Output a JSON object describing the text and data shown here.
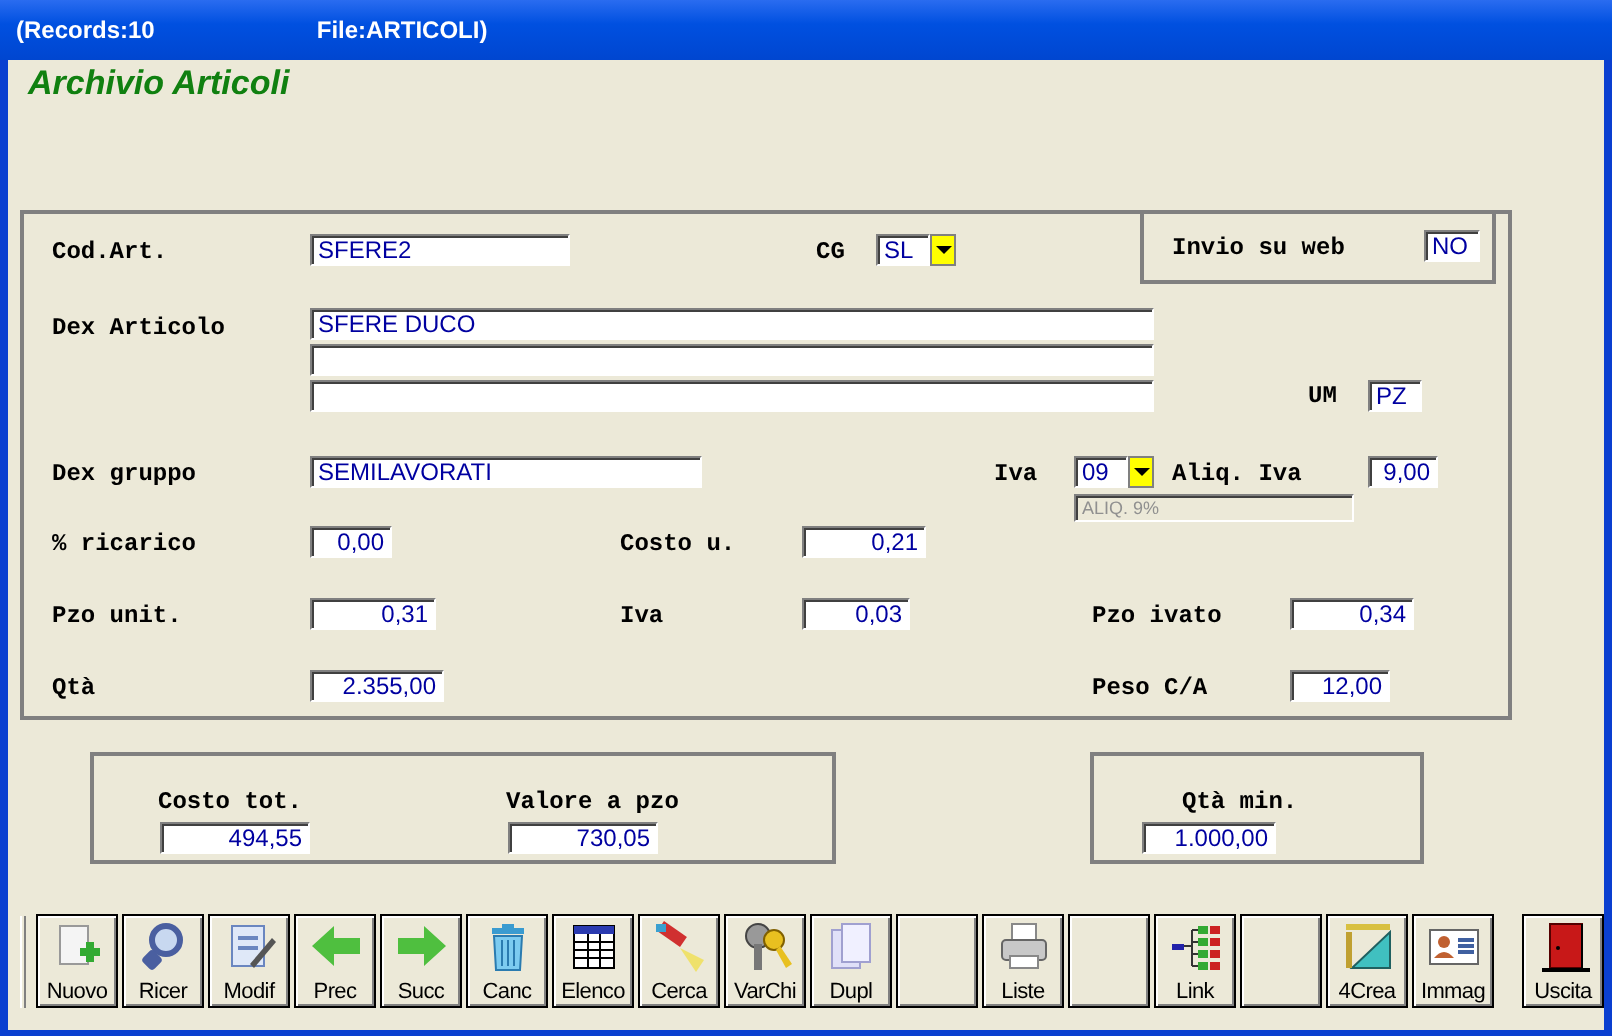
{
  "title_bar": {
    "records": "(Records:10",
    "file": "File:ARTICOLI)"
  },
  "heading": "Archivio Articoli",
  "main_form": {
    "fields": [
      {
        "label": "Cod.Art.",
        "kind": "text",
        "value": "SFERE2"
      },
      {
        "label": "CG",
        "kind": "combo",
        "value": "SL"
      },
      {
        "label": "Dex Articolo",
        "kind": "multiline",
        "value": "SFERE DUCO"
      },
      {
        "label": "UM",
        "kind": "text",
        "value": "PZ"
      },
      {
        "label": "Dex gruppo",
        "kind": "text",
        "value": "SEMILAVORATI"
      },
      {
        "label": "Iva",
        "kind": "combo",
        "value": "09"
      },
      {
        "label": "Aliq. Iva",
        "kind": "number",
        "value": "9,00"
      },
      {
        "kind": "readonly",
        "value": "ALIQ. 9%"
      },
      {
        "label": "% ricarico",
        "kind": "number",
        "value": "0,00"
      },
      {
        "label": "Costo u.",
        "kind": "number",
        "value": "0,21"
      },
      {
        "label": "Pzo unit.",
        "kind": "number",
        "value": "0,31"
      },
      {
        "label": "Iva",
        "kind": "number",
        "value": "0,03"
      },
      {
        "label": "Pzo ivato",
        "kind": "number",
        "value": "0,34"
      },
      {
        "label": "Qtà",
        "kind": "number",
        "value": "2.355,00"
      },
      {
        "label": "Peso C/A",
        "kind": "number",
        "value": "12,00"
      }
    ]
  },
  "web_box": {
    "label": "Invio su web",
    "value": "NO"
  },
  "totals": [
    {
      "label": "Costo tot.",
      "value": "494,55"
    },
    {
      "label": "Valore a pzo",
      "value": "730,05"
    }
  ],
  "min_box": {
    "label": "Qtà min.",
    "value": "1.000,00"
  },
  "toolbar": [
    {
      "kind": "new",
      "label": "Nuovo"
    },
    {
      "kind": "search",
      "label": "Ricer"
    },
    {
      "kind": "edit",
      "label": "Modif"
    },
    {
      "kind": "back",
      "label": "Prec"
    },
    {
      "kind": "forward",
      "label": "Succ"
    },
    {
      "kind": "delete",
      "label": "Canc"
    },
    {
      "kind": "table",
      "label": "Elenco"
    },
    {
      "kind": "find",
      "label": "Cerca"
    },
    {
      "kind": "keys",
      "label": "VarChi"
    },
    {
      "kind": "copy",
      "label": "Dupl"
    },
    {
      "kind": "blank"
    },
    {
      "kind": "print",
      "label": "Liste"
    },
    {
      "kind": "blank"
    },
    {
      "kind": "link",
      "label": "Link"
    },
    {
      "kind": "blank"
    },
    {
      "kind": "tools",
      "label": "4Crea"
    },
    {
      "kind": "card",
      "label": "Immag"
    },
    {
      "kind": "exit",
      "label": "Uscita"
    }
  ]
}
